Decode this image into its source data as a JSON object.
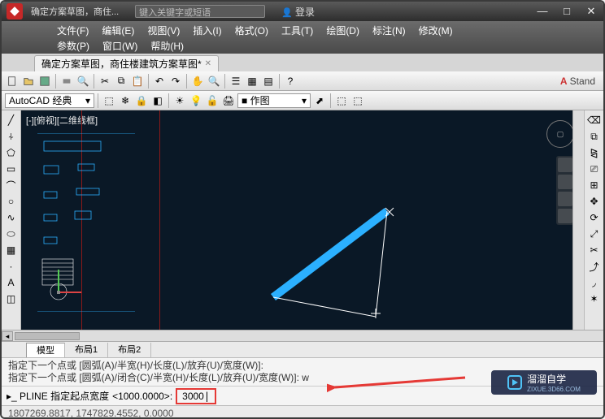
{
  "titlebar": {
    "title_main": "确定方案草图，商住...",
    "search_placeholder": "键入关键字或短语",
    "login": "登录"
  },
  "menus": {
    "file": "文件(F)",
    "edit": "编辑(E)",
    "view": "视图(V)",
    "insert": "插入(I)",
    "format": "格式(O)",
    "tools": "工具(T)",
    "draw": "绘图(D)",
    "dimension": "标注(N)",
    "modify": "修改(M)",
    "parametric": "参数(P)",
    "window": "窗口(W)",
    "help": "帮助(H)"
  },
  "tab": {
    "label": "确定方案草图，商住楼建筑方案草图*"
  },
  "workspace": {
    "name": "AutoCAD 经典",
    "layer_label": "作图"
  },
  "toolbar_right": "Stand",
  "viewport": {
    "label": "[-][俯视][二维线框]"
  },
  "layout_tabs": {
    "model": "模型",
    "l1": "布局1",
    "l2": "布局2"
  },
  "cmd_history": {
    "line1": "指定下一个点或 [圆弧(A)/半宽(H)/长度(L)/放弃(U)/宽度(W)]:",
    "line2": "指定下一个点或 [圆弧(A)/闭合(C)/半宽(H)/长度(L)/放弃(U)/宽度(W)]: w"
  },
  "cmd": {
    "prefix": "PLINE 指定起点宽度",
    "default": "<1000.0000>:",
    "input": "3000"
  },
  "status": {
    "coords": "1807269.8817, 1747829.4552, 0.0000"
  },
  "watermark": {
    "brand": "溜溜自学",
    "url": "ZIXUE.3D66.COM"
  }
}
